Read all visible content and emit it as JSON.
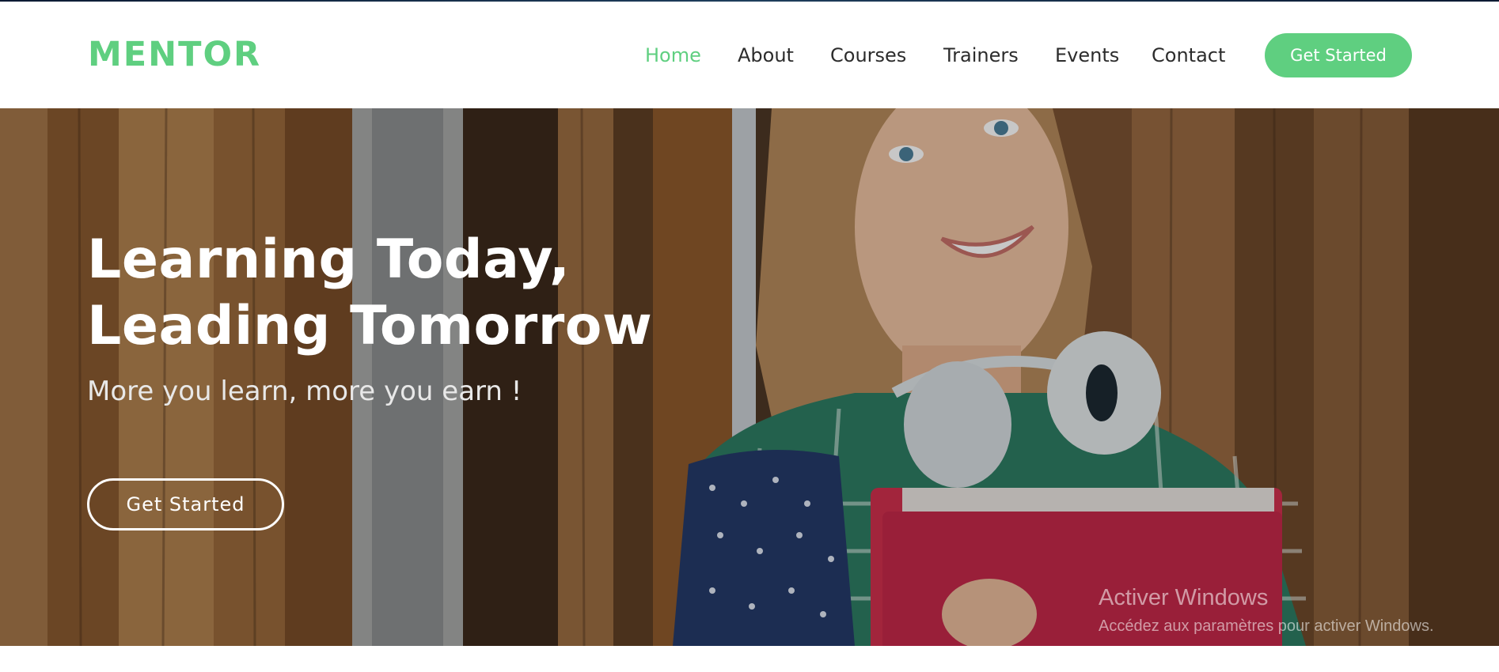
{
  "brand": {
    "logo": "MENTOR",
    "accent_color": "#5fcf80"
  },
  "nav": {
    "items": [
      {
        "label": "Home",
        "active": true
      },
      {
        "label": "About",
        "active": false
      },
      {
        "label": "Courses",
        "active": false
      },
      {
        "label": "Trainers",
        "active": false
      },
      {
        "label": "Events",
        "active": false
      },
      {
        "label": "Contact",
        "active": false
      }
    ],
    "cta_label": "Get Started"
  },
  "hero": {
    "title_line1": "Learning Today,",
    "title_line2": "Leading Tomorrow",
    "subtitle": "More you learn, more you earn !",
    "cta_label": "Get Started",
    "image": "student with headphones and red folder"
  },
  "watermark": {
    "title": "Activer Windows",
    "subtitle": "Accédez aux paramètres pour activer Windows."
  }
}
